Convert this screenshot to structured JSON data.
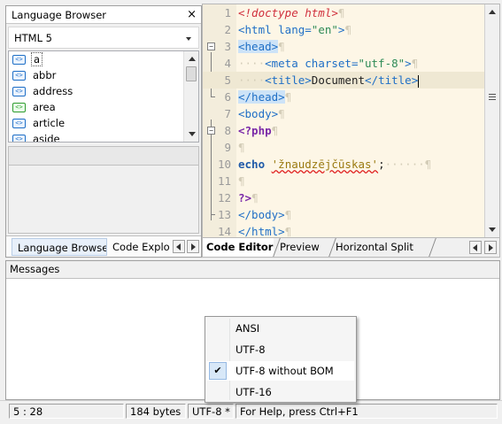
{
  "language_browser": {
    "title": "Language Browser",
    "close_glyph": "×",
    "language": "HTML 5",
    "items": [
      {
        "label": "a",
        "icon": "tag-icon"
      },
      {
        "label": "abbr",
        "icon": "tag-icon"
      },
      {
        "label": "address",
        "icon": "tag-icon"
      },
      {
        "label": "area",
        "icon": "tag-icon-green"
      },
      {
        "label": "article",
        "icon": "tag-icon"
      },
      {
        "label": "aside",
        "icon": "tag-icon"
      }
    ],
    "tabs": [
      "Language Browser",
      "Code Explor"
    ]
  },
  "editor": {
    "lines": [
      {
        "n": "1",
        "tokens": [
          [
            "c-doctype",
            "<!doctype html>"
          ],
          [
            "c-ws",
            "¶"
          ]
        ]
      },
      {
        "n": "2",
        "tokens": [
          [
            "c-tag",
            "<html "
          ],
          [
            "c-attr",
            "lang="
          ],
          [
            "c-val",
            "\"en\""
          ],
          [
            "c-tag",
            ">"
          ],
          [
            "c-ws",
            "¶"
          ]
        ]
      },
      {
        "n": "3",
        "tokens": [
          [
            "c-tag hl-tag",
            "<head>"
          ],
          [
            "c-ws",
            "¶"
          ]
        ]
      },
      {
        "n": "4",
        "tokens": [
          [
            "c-ws",
            "····"
          ],
          [
            "c-tag",
            "<meta "
          ],
          [
            "c-attr",
            "charset="
          ],
          [
            "c-val",
            "\"utf-8\""
          ],
          [
            "c-tag",
            ">"
          ],
          [
            "c-ws",
            "¶"
          ]
        ]
      },
      {
        "n": "5",
        "tokens": [
          [
            "c-ws",
            "····"
          ],
          [
            "c-tag",
            "<title>"
          ],
          [
            "c-text",
            "Document"
          ],
          [
            "c-tag",
            "</title>"
          ]
        ]
      },
      {
        "n": "6",
        "tokens": [
          [
            "c-tag hl-tag",
            "</head>"
          ],
          [
            "c-ws",
            "¶"
          ]
        ]
      },
      {
        "n": "7",
        "tokens": [
          [
            "c-tag",
            "<body>"
          ],
          [
            "c-ws",
            "¶"
          ]
        ]
      },
      {
        "n": "8",
        "tokens": [
          [
            "c-php",
            "<?php"
          ],
          [
            "c-ws",
            "¶"
          ]
        ]
      },
      {
        "n": "9",
        "tokens": [
          [
            "c-ws",
            "¶"
          ]
        ]
      },
      {
        "n": "10",
        "tokens": [
          [
            "c-kw",
            "echo "
          ],
          [
            "c-str squiggle",
            "'žnaudzējčūskas'"
          ],
          [
            "c-text",
            ";"
          ],
          [
            "c-ws",
            "······¶"
          ]
        ]
      },
      {
        "n": "11",
        "tokens": [
          [
            "c-ws",
            "¶"
          ]
        ]
      },
      {
        "n": "12",
        "tokens": [
          [
            "c-php",
            "?>"
          ],
          [
            "c-ws",
            "¶"
          ]
        ]
      },
      {
        "n": "13",
        "tokens": [
          [
            "c-tag",
            "</body>"
          ],
          [
            "c-ws",
            "¶"
          ]
        ]
      },
      {
        "n": "14",
        "tokens": [
          [
            "c-tag",
            "</html>"
          ],
          [
            "c-ws",
            "¶"
          ]
        ]
      }
    ],
    "tabs": [
      "Code Editor",
      "Preview",
      "Horizontal Split"
    ]
  },
  "messages": {
    "title": "Messages"
  },
  "status": {
    "position": "5 : 28",
    "size": "184 bytes",
    "encoding": "UTF-8 *",
    "help": "For Help, press Ctrl+F1"
  },
  "encoding_menu": {
    "items": [
      "ANSI",
      "UTF-8",
      "UTF-8 without BOM",
      "UTF-16"
    ],
    "checked_index": 2,
    "check_glyph": "✔"
  },
  "colors": {
    "editor_bg": "#fdf6e6",
    "tag": "#1f6fc6",
    "doctype": "#d0303d",
    "php": "#7a28a8"
  }
}
